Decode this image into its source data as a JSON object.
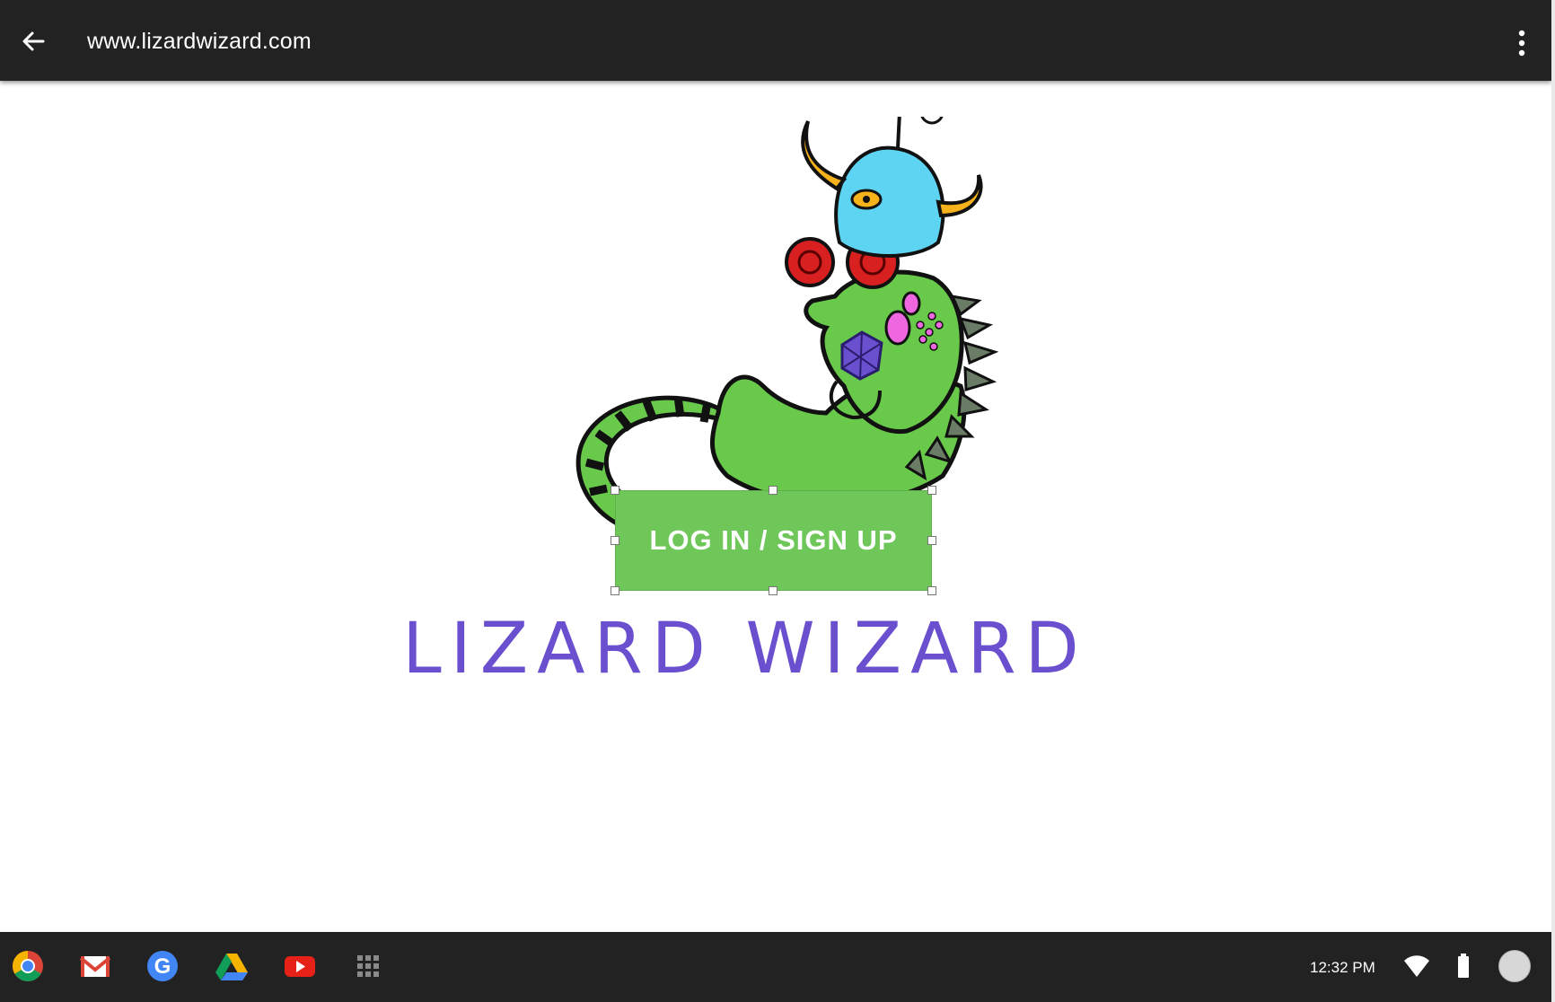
{
  "app_bar": {
    "url": "www.lizardwizard.com",
    "back_icon": "arrow-back-icon",
    "menu_icon": "more-vert-icon"
  },
  "main": {
    "login_button_label": "LOG IN / SIGN UP",
    "brand_title": "LIZARD WIZARD",
    "mascot": "lizard-wizard-mascot-illustration"
  },
  "shelf": {
    "apps": [
      {
        "name": "chrome-icon"
      },
      {
        "name": "gmail-icon"
      },
      {
        "name": "google-icon"
      },
      {
        "name": "drive-icon"
      },
      {
        "name": "youtube-icon"
      },
      {
        "name": "app-launcher-icon"
      }
    ],
    "time": "12:32 PM",
    "status_icons": [
      "wifi-icon",
      "battery-icon",
      "account-avatar"
    ]
  },
  "colors": {
    "bar_bg": "#222222",
    "button_green": "#6fc75a",
    "brand_purple": "#6a50cf",
    "lizard_green": "#69c94a",
    "monster_blue": "#5cd4f2",
    "horn_yellow": "#f5b21b"
  }
}
